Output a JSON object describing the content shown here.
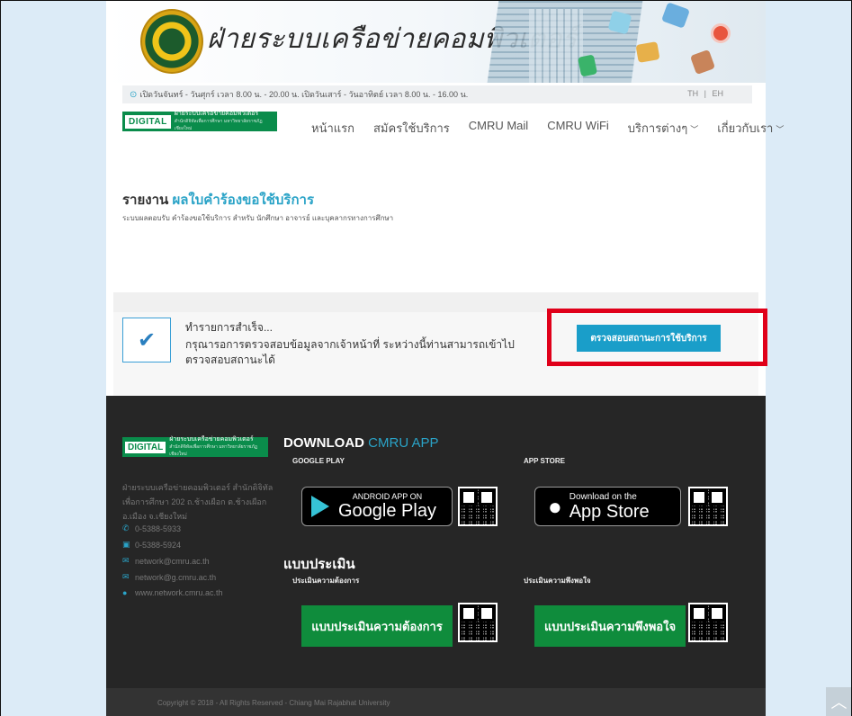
{
  "header": {
    "site_title": "ฝ่ายระบบเครือข่ายคอมพิวเตอร์",
    "hours": "เปิดวันจันทร์ - วันศุกร์ เวลา 8.00 น. - 20.00 น. เปิดวันเสาร์ - วันอาทิตย์ เวลา 8.00 น. - 16.00 น.",
    "lang_th": "TH",
    "lang_sep": "|",
    "lang_en": "EH"
  },
  "logo": {
    "badge": "DIGITAL",
    "line1": "ฝ่ายระบบเครือข่ายคอมพิวเตอร์",
    "line2": "สำนักดิจิทัลเพื่อการศึกษา มหาวิทยาลัยราชภัฏเชียงใหม่"
  },
  "nav": {
    "items": [
      {
        "label": "หน้าแรก",
        "dropdown": false
      },
      {
        "label": "สมัครใช้บริการ",
        "dropdown": false
      },
      {
        "label": "CMRU Mail",
        "dropdown": false
      },
      {
        "label": "CMRU WiFi",
        "dropdown": false
      },
      {
        "label": "บริการต่างๆ",
        "dropdown": true
      },
      {
        "label": "เกี่ยวกับเรา",
        "dropdown": true
      }
    ]
  },
  "report": {
    "title_prefix": "รายงาน",
    "title_highlight": "ผลใบคำร้องขอใช้บริการ",
    "subtitle": "ระบบผลตอบรับ คำร้องขอใช้บริการ สำหรับ นักศึกษา อาจารย์ และบุคลากรทางการศึกษา"
  },
  "panel": {
    "heading": "ทำรายการสำเร็จ...",
    "body": "กรุณารอการตรวจสอบข้อมูลจากเจ้าหน้าที่ ระหว่างนี้ท่านสามารถเข้าไปตรวจสอบสถานะได้",
    "button": "ตรวจสอบสถานะการใช้บริการ"
  },
  "footer": {
    "address": "ฝ่ายระบบเครือข่ายคอมพิวเตอร์ สำนักดิจิทัลเพื่อการศึกษา 202 ถ.ช้างเผือก ต.ช้างเผือก อ.เมือง จ.เชียงใหม่",
    "phone": "0-5388-5933",
    "fax": "0-5388-5924",
    "email1": "network@cmru.ac.th",
    "email2": "network@g.cmru.ac.th",
    "website": "www.network.cmru.ac.th",
    "download_prefix": "DOWNLOAD",
    "download_highlight": "CMRU APP",
    "google_label": "GOOGLE PLAY",
    "google_small": "ANDROID APP ON",
    "google_big": "Google Play",
    "appstore_label": "APP STORE",
    "appstore_small": "Download on the",
    "appstore_big": "App Store",
    "eval_title": "แบบประเมิน",
    "eval_need_label": "ประเมินความต้องการ",
    "eval_need_button": "แบบประเมินความต้องการ",
    "eval_sat_label": "ประเมินความพึงพอใจ",
    "eval_sat_button": "แบบประเมินความพึงพอใจ",
    "copyright": "Copyright © 2018 - All Rights Reserved - Chiang Mai Rajabhat University"
  },
  "colors": {
    "accent": "#2aa3c7",
    "brand_green": "#0a8c4b",
    "highlight_red": "#e0001a",
    "footer_bg": "#262626"
  }
}
